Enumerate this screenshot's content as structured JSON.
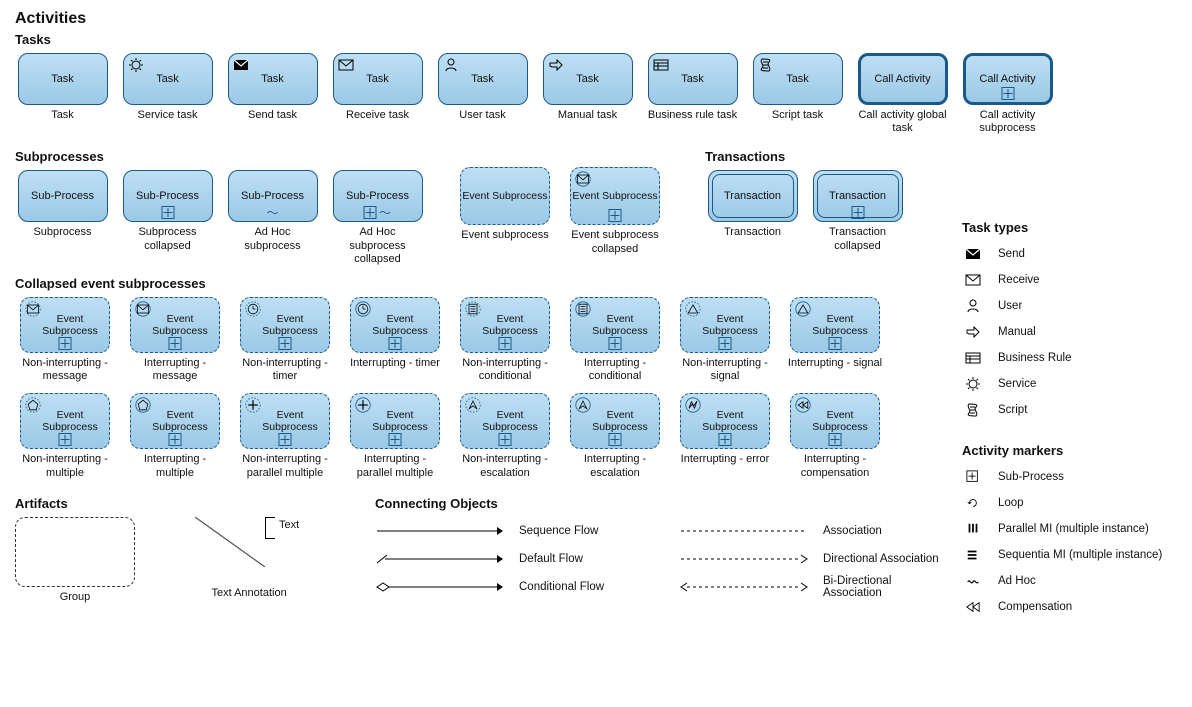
{
  "titles": {
    "activities": "Activities",
    "tasks": "Tasks",
    "subprocesses": "Subprocesses",
    "transactions": "Transactions",
    "collapsed": "Collapsed event subprocesses",
    "artifacts": "Artifacts",
    "connecting": "Connecting Objects",
    "task_types": "Task types",
    "activity_markers": "Activity markers"
  },
  "tasks": [
    {
      "label": "Task",
      "caption": "Task",
      "icon": ""
    },
    {
      "label": "Task",
      "caption": "Service task",
      "icon": "service"
    },
    {
      "label": "Task",
      "caption": "Send task",
      "icon": "send"
    },
    {
      "label": "Task",
      "caption": "Receive task",
      "icon": "receive"
    },
    {
      "label": "Task",
      "caption": "User task",
      "icon": "user"
    },
    {
      "label": "Task",
      "caption": "Manual task",
      "icon": "manual"
    },
    {
      "label": "Task",
      "caption": "Business rule task",
      "icon": "businessrule"
    },
    {
      "label": "Task",
      "caption": "Script task",
      "icon": "script"
    },
    {
      "label": "Call Activity",
      "caption": "Call activity global task",
      "icon": "",
      "thick": true
    },
    {
      "label": "Call Activity",
      "caption": "Call activity subprocess",
      "icon": "",
      "thick": true,
      "marker": "plus"
    }
  ],
  "subprocesses": [
    {
      "label": "Sub-Process",
      "caption": "Subprocess"
    },
    {
      "label": "Sub-Process",
      "caption": "Subprocess collapsed",
      "marker": "plus"
    },
    {
      "label": "Sub-Process",
      "caption": "Ad Hoc subprocess",
      "marker": "tilde"
    },
    {
      "label": "Sub-Process",
      "caption": "Ad Hoc subprocess collapsed",
      "marker": "plus-tilde"
    }
  ],
  "event_subprocesses_top": [
    {
      "label": "Event Subprocess",
      "caption": "Event subprocess"
    },
    {
      "label": "Event Subprocess",
      "caption": "Event subprocess collapsed",
      "marker": "plus",
      "icon": "receive",
      "circle": "solid"
    }
  ],
  "transactions": [
    {
      "label": "Transaction",
      "caption": "Transaction"
    },
    {
      "label": "Transaction",
      "caption": "Transaction collapsed",
      "marker": "plus"
    }
  ],
  "collapsed_rows": [
    [
      {
        "caption": "Non-interrupting - message",
        "icon": "receive",
        "circle": "dashed"
      },
      {
        "caption": "Interrupting - message",
        "icon": "receive",
        "circle": "solid"
      },
      {
        "caption": "Non-interrupting - timer",
        "icon": "timer",
        "circle": "dashed"
      },
      {
        "caption": "Interrupting - timer",
        "icon": "timer",
        "circle": "solid"
      },
      {
        "caption": "Non-interrupting - conditional",
        "icon": "conditional",
        "circle": "dashed"
      },
      {
        "caption": "Interrupting - conditional",
        "icon": "conditional",
        "circle": "solid"
      },
      {
        "caption": "Non-interrupting - signal",
        "icon": "signal",
        "circle": "dashed"
      },
      {
        "caption": "Interrupting - signal",
        "icon": "signal",
        "circle": "solid"
      }
    ],
    [
      {
        "caption": "Non-interrupting - multiple",
        "icon": "multiple",
        "circle": "dashed"
      },
      {
        "caption": "Interrupting - multiple",
        "icon": "multiple",
        "circle": "solid"
      },
      {
        "caption": "Non-interrupting - parallel multiple",
        "icon": "parallel",
        "circle": "dashed"
      },
      {
        "caption": "Interrupting - parallel multiple",
        "icon": "parallel",
        "circle": "solid"
      },
      {
        "caption": "Non-interrupting - escalation",
        "icon": "escalation",
        "circle": "dashed"
      },
      {
        "caption": "Interrupting - escalation",
        "icon": "escalation",
        "circle": "solid"
      },
      {
        "caption": "Interrupting - error",
        "icon": "error",
        "circle": "solid"
      },
      {
        "caption": "Interrupting - compensation",
        "icon": "compensation",
        "circle": "solid"
      }
    ]
  ],
  "collapsed_label": "Event Subprocess",
  "artifacts": {
    "group": "Group",
    "text_annotation": "Text Annotation",
    "text": "Text"
  },
  "connecting_left": [
    {
      "label": "Sequence Flow",
      "kind": "seq"
    },
    {
      "label": "Default Flow",
      "kind": "def"
    },
    {
      "label": "Conditional Flow",
      "kind": "cond"
    }
  ],
  "connecting_right": [
    {
      "label": "Association",
      "kind": "assoc"
    },
    {
      "label": "Directional Association",
      "kind": "dassoc"
    },
    {
      "label": "Bi-Directional Association",
      "kind": "biassoc"
    }
  ],
  "task_types_legend": [
    {
      "label": "Send",
      "icon": "send"
    },
    {
      "label": "Receive",
      "icon": "receive"
    },
    {
      "label": "User",
      "icon": "user"
    },
    {
      "label": "Manual",
      "icon": "manual"
    },
    {
      "label": "Business Rule",
      "icon": "businessrule"
    },
    {
      "label": "Service",
      "icon": "service"
    },
    {
      "label": "Script",
      "icon": "script"
    }
  ],
  "activity_markers_legend": [
    {
      "label": "Sub-Process",
      "icon": "plusbox"
    },
    {
      "label": "Loop",
      "icon": "loop"
    },
    {
      "label": "Parallel MI (multiple instance)",
      "icon": "pmi"
    },
    {
      "label": "Sequentia MI (multiple instance)",
      "icon": "smi"
    },
    {
      "label": "Ad Hoc",
      "icon": "adhoc"
    },
    {
      "label": "Compensation",
      "icon": "comp"
    }
  ]
}
